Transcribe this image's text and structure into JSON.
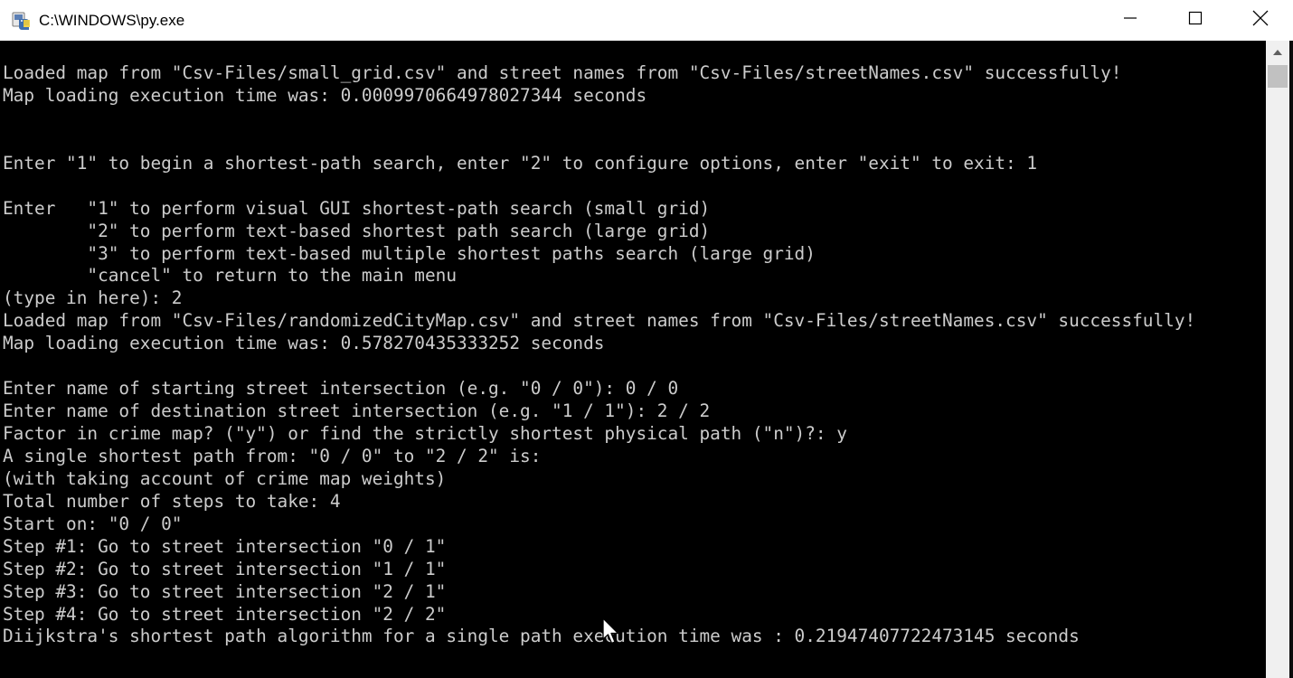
{
  "window": {
    "title": "C:\\WINDOWS\\py.exe",
    "icon": "python-launcher-icon",
    "controls": {
      "minimize_icon": "minimize-icon",
      "maximize_icon": "maximize-icon",
      "close_icon": "close-icon"
    }
  },
  "console": {
    "foreground": "#cccccc",
    "background": "#000000",
    "lines": [
      "Loaded map from \"Csv-Files/small_grid.csv\" and street names from \"Csv-Files/streetNames.csv\" successfully!",
      "Map loading execution time was: 0.0009970664978027344 seconds",
      "",
      "",
      "Enter \"1\" to begin a shortest-path search, enter \"2\" to configure options, enter \"exit\" to exit: 1",
      "",
      "Enter   \"1\" to perform visual GUI shortest-path search (small grid)",
      "        \"2\" to perform text-based shortest path search (large grid)",
      "        \"3\" to perform text-based multiple shortest paths search (large grid)",
      "        \"cancel\" to return to the main menu",
      "(type in here): 2",
      "Loaded map from \"Csv-Files/randomizedCityMap.csv\" and street names from \"Csv-Files/streetNames.csv\" successfully!",
      "Map loading execution time was: 0.578270435333252 seconds",
      "",
      "Enter name of starting street intersection (e.g. \"0 / 0\"): 0 / 0",
      "Enter name of destination street intersection (e.g. \"1 / 1\"): 2 / 2",
      "Factor in crime map? (\"y\") or find the strictly shortest physical path (\"n\")?: y",
      "A single shortest path from: \"0 / 0\" to \"2 / 2\" is:",
      "(with taking account of crime map weights)",
      "Total number of steps to take: 4",
      "Start on: \"0 / 0\"",
      "Step #1: Go to street intersection \"0 / 1\"",
      "Step #2: Go to street intersection \"1 / 1\"",
      "Step #3: Go to street intersection \"2 / 1\"",
      "Step #4: Go to street intersection \"2 / 2\"",
      "Diijkstra's shortest path algorithm for a single path execution time was : 0.21947407722473145 seconds"
    ]
  },
  "scrollbar": {
    "up_icon": "scroll-up-arrow-icon"
  },
  "pointer": {
    "icon": "mouse-cursor-icon"
  }
}
